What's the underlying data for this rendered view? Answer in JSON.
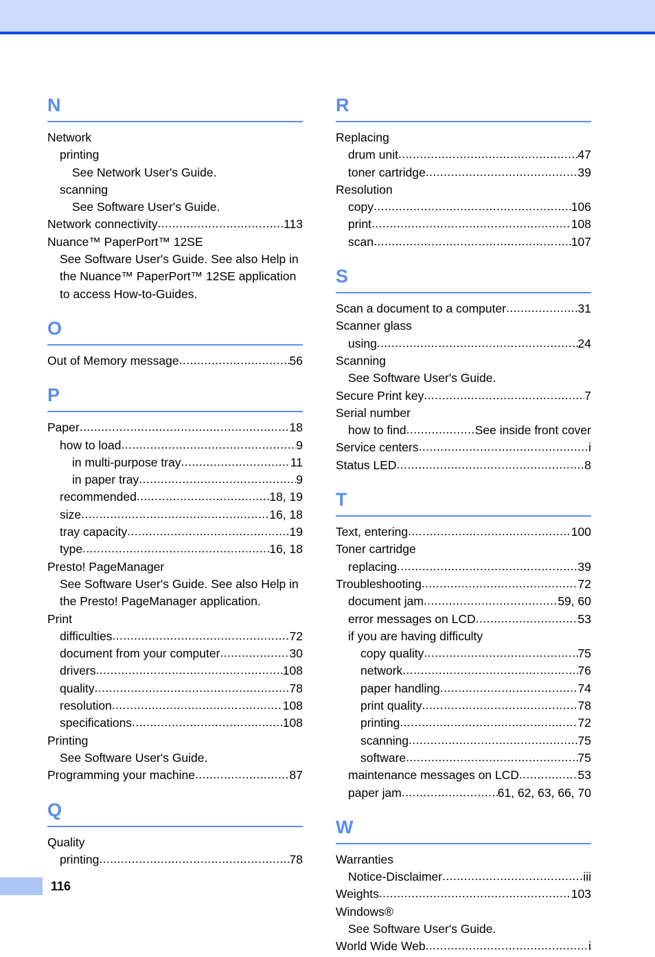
{
  "document": {
    "page_number": "116",
    "colors": {
      "header_band": "#ccdcfa",
      "header_rule": "#0a4de8",
      "letter_accent": "#5a8cf0",
      "footer_bar": "#aec6f5",
      "text": "#000000"
    }
  },
  "columns": [
    {
      "name": "left-column",
      "sections": [
        {
          "letter": "N",
          "entries": [
            {
              "level": 0,
              "label": "Network",
              "page": ""
            },
            {
              "level": 1,
              "label": "printing",
              "page": ""
            },
            {
              "level": 2,
              "label": "See Network User's Guide.",
              "page": ""
            },
            {
              "level": 1,
              "label": "scanning",
              "page": ""
            },
            {
              "level": 2,
              "label": "See Software User's Guide.",
              "page": ""
            },
            {
              "level": 0,
              "label": "Network connectivity",
              "page": "113"
            },
            {
              "level": 0,
              "label": "Nuance™ PaperPort™ 12SE",
              "page": ""
            },
            {
              "level": 1,
              "label": "See Software User's Guide. See also Help in the Nuance™ PaperPort™ 12SE application to access How-to-Guides.",
              "page": "",
              "wrap": true
            }
          ]
        },
        {
          "letter": "O",
          "entries": [
            {
              "level": 0,
              "label": "Out of Memory message",
              "page": "56"
            }
          ]
        },
        {
          "letter": "P",
          "entries": [
            {
              "level": 0,
              "label": "Paper",
              "page": "18"
            },
            {
              "level": 1,
              "label": "how to load",
              "page": "9"
            },
            {
              "level": 2,
              "label": "in multi-purpose tray",
              "page": "11"
            },
            {
              "level": 2,
              "label": "in paper tray",
              "page": "9"
            },
            {
              "level": 1,
              "label": "recommended",
              "page": "18, 19"
            },
            {
              "level": 1,
              "label": "size",
              "page": "16, 18"
            },
            {
              "level": 1,
              "label": "tray capacity",
              "page": "19"
            },
            {
              "level": 1,
              "label": "type",
              "page": "16, 18"
            },
            {
              "level": 0,
              "label": "Presto! PageManager",
              "page": ""
            },
            {
              "level": 1,
              "label": "See Software User's Guide. See also Help in the Presto! PageManager application.",
              "page": "",
              "wrap": true
            },
            {
              "level": 0,
              "label": "Print",
              "page": ""
            },
            {
              "level": 1,
              "label": "difficulties",
              "page": "72"
            },
            {
              "level": 1,
              "label": "document from your computer",
              "page": "30"
            },
            {
              "level": 1,
              "label": "drivers",
              "page": "108"
            },
            {
              "level": 1,
              "label": "quality",
              "page": "78"
            },
            {
              "level": 1,
              "label": "resolution",
              "page": "108"
            },
            {
              "level": 1,
              "label": "specifications",
              "page": "108"
            },
            {
              "level": 0,
              "label": "Printing",
              "page": ""
            },
            {
              "level": 1,
              "label": "See Software User's Guide.",
              "page": ""
            },
            {
              "level": 0,
              "label": "Programming your machine",
              "page": "87"
            }
          ]
        },
        {
          "letter": "Q",
          "entries": [
            {
              "level": 0,
              "label": "Quality",
              "page": ""
            },
            {
              "level": 1,
              "label": "printing",
              "page": "78"
            }
          ]
        }
      ]
    },
    {
      "name": "right-column",
      "sections": [
        {
          "letter": "R",
          "entries": [
            {
              "level": 0,
              "label": "Replacing",
              "page": ""
            },
            {
              "level": 1,
              "label": "drum unit",
              "page": "47"
            },
            {
              "level": 1,
              "label": "toner cartridge",
              "page": "39"
            },
            {
              "level": 0,
              "label": "Resolution",
              "page": ""
            },
            {
              "level": 1,
              "label": "copy",
              "page": "106"
            },
            {
              "level": 1,
              "label": "print",
              "page": "108"
            },
            {
              "level": 1,
              "label": "scan",
              "page": "107"
            }
          ]
        },
        {
          "letter": "S",
          "entries": [
            {
              "level": 0,
              "label": "Scan a document to a computer",
              "page": "31"
            },
            {
              "level": 0,
              "label": "Scanner glass",
              "page": ""
            },
            {
              "level": 1,
              "label": "using",
              "page": "24"
            },
            {
              "level": 0,
              "label": "Scanning",
              "page": ""
            },
            {
              "level": 1,
              "label": "See Software User's Guide.",
              "page": ""
            },
            {
              "level": 0,
              "label": "Secure Print key",
              "page": "7"
            },
            {
              "level": 0,
              "label": "Serial number",
              "page": ""
            },
            {
              "level": 1,
              "label": "how to find",
              "page": "See inside front cover"
            },
            {
              "level": 0,
              "label": "Service centers",
              "page": "i"
            },
            {
              "level": 0,
              "label": "Status LED",
              "page": "8"
            }
          ]
        },
        {
          "letter": "T",
          "entries": [
            {
              "level": 0,
              "label": "Text, entering",
              "page": "100"
            },
            {
              "level": 0,
              "label": "Toner cartridge",
              "page": ""
            },
            {
              "level": 1,
              "label": "replacing",
              "page": "39"
            },
            {
              "level": 0,
              "label": "Troubleshooting",
              "page": "72"
            },
            {
              "level": 1,
              "label": "document jam",
              "page": "59, 60"
            },
            {
              "level": 1,
              "label": "error messages on LCD",
              "page": "53"
            },
            {
              "level": 1,
              "label": "if you are having difficulty",
              "page": ""
            },
            {
              "level": 2,
              "label": "copy quality",
              "page": "75"
            },
            {
              "level": 2,
              "label": "network",
              "page": "76"
            },
            {
              "level": 2,
              "label": "paper handling",
              "page": "74"
            },
            {
              "level": 2,
              "label": "print quality",
              "page": "78"
            },
            {
              "level": 2,
              "label": "printing",
              "page": "72"
            },
            {
              "level": 2,
              "label": "scanning",
              "page": "75"
            },
            {
              "level": 2,
              "label": "software",
              "page": "75"
            },
            {
              "level": 1,
              "label": "maintenance messages on LCD",
              "page": "53"
            },
            {
              "level": 1,
              "label": "paper jam",
              "page": "61, 62, 63, 66, 70"
            }
          ]
        },
        {
          "letter": "W",
          "entries": [
            {
              "level": 0,
              "label": "Warranties",
              "page": ""
            },
            {
              "level": 1,
              "label": "Notice-Disclaimer",
              "page": "iii"
            },
            {
              "level": 0,
              "label": "Weights",
              "page": "103"
            },
            {
              "level": 0,
              "label": "Windows®",
              "page": "",
              "sup_tail": "®"
            },
            {
              "level": 1,
              "label": "See Software User's Guide.",
              "page": ""
            },
            {
              "level": 0,
              "label": "World Wide Web",
              "page": "i"
            }
          ]
        }
      ]
    }
  ]
}
